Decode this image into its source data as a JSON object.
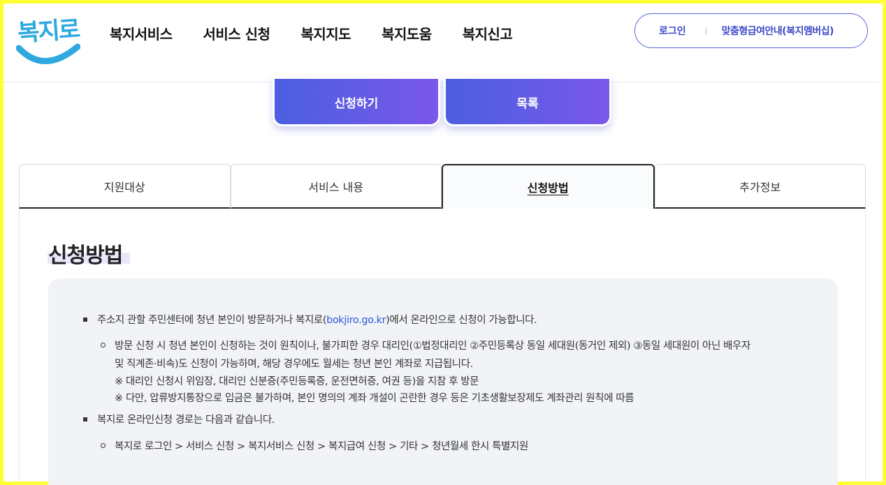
{
  "brand": {
    "logo_text": "복지로",
    "logo_color": "#2fa8e0"
  },
  "gnb": {
    "items": [
      {
        "label": "복지서비스"
      },
      {
        "label": "서비스 신청"
      },
      {
        "label": "복지지도"
      },
      {
        "label": "복지도움"
      },
      {
        "label": "복지신고"
      }
    ]
  },
  "util": {
    "login_label": "로그인",
    "member_label": "맞춤형급여안내(복지멤버십)",
    "accent": "#3d4ac8"
  },
  "actions": {
    "apply_label": "신청하기",
    "list_label": "목록"
  },
  "tabs": [
    {
      "label": "지원대상",
      "active": false
    },
    {
      "label": "서비스 내용",
      "active": false
    },
    {
      "label": "신청방법",
      "active": true
    },
    {
      "label": "추가정보",
      "active": false
    }
  ],
  "section": {
    "title": "신청방법",
    "bullets": {
      "b1_before": "주소지 관할 주민센터에 청년 본인이 방문하거나 복지로(",
      "b1_link": "bokjiro.go.kr",
      "b1_after": ")에서 온라인으로 신청이 가능합니다.",
      "b1_sub_line1": "방문 신청 시 청년 본인이 신청하는 것이 원칙이나, 불가피한 경우 대리인(①법정대리인 ②주민등록상 동일 세대원(동거인 제외) ③동일 세대원이 아닌 배우자",
      "b1_sub_line2": "및 직계존·비속)도 신청이 가능하며, 해당 경우에도 월세는 청년 본인 계좌로 지급됩니다.",
      "b1_note1": "※ 대리인 신청시 위임장, 대리인 신분증(주민등록증, 운전면허증, 여권 등)을 지참 후 방문",
      "b1_note2": "※ 다만, 압류방지통장으로 입금은 불가하며, 본인 명의의 계좌 개설이 곤란한 경우 등은 기초생활보장제도 계좌관리 원칙에 따름",
      "b2": "복지로 온라인신청 경로는 다음과 같습니다.",
      "b2_sub": "복지로 로그인 > 서비스 신청 > 복지서비스 신청 > 복지급여 신청 > 기타 > 청년월세 한시 특별지원"
    }
  }
}
